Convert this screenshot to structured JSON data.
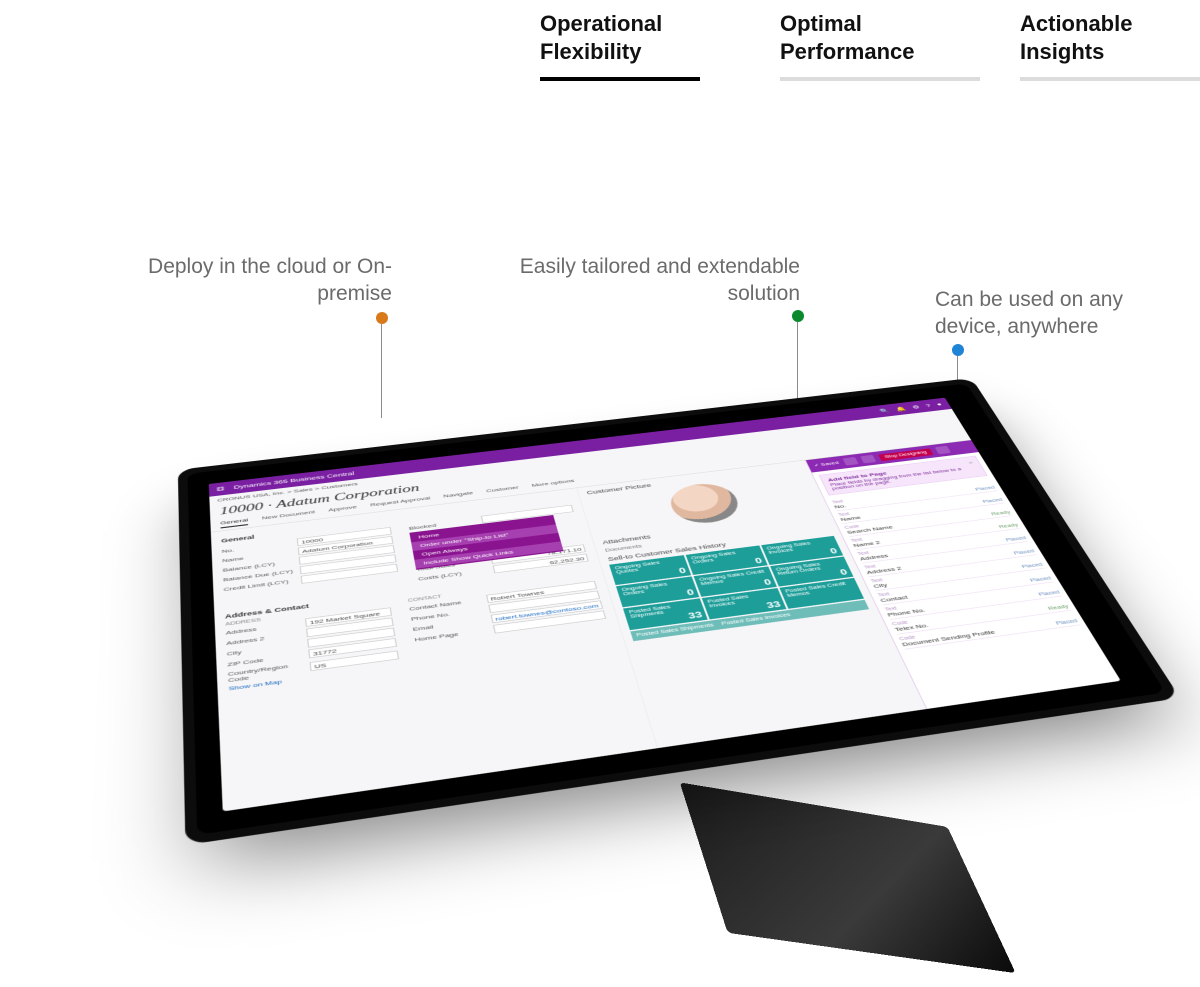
{
  "tabs": [
    {
      "label": "Operational\nFlexibility",
      "active": true
    },
    {
      "label": "Optimal\nPerformance",
      "active": false
    },
    {
      "label": "Actionable\nInsights",
      "active": false
    }
  ],
  "callouts": {
    "deploy": "Deploy in the cloud or On-premise",
    "tailor": "Easily tailored and extendable solution",
    "device": "Can be used on any device, anywhere"
  },
  "app": {
    "product": "Dynamics 365 Business Central",
    "breadcrumb": "CRONUS USA, Inc. > Sales > Customers",
    "page_title": "10000 · Adatum Corporation",
    "ribbon": [
      "General",
      "New Document",
      "Approve",
      "Request Approval",
      "Navigate",
      "Customer",
      "More options"
    ],
    "ribbon_active": "General",
    "sections": {
      "general": {
        "title": "General",
        "fields": {
          "no": {
            "label": "No.",
            "value": "10000"
          },
          "name": {
            "label": "Name",
            "value": "Adatum Corporation"
          },
          "balance": {
            "label": "Balance (LCY)",
            "value": ""
          },
          "balance_due": {
            "label": "Balance Due (LCY)",
            "value": ""
          },
          "credit_limit": {
            "label": "Credit Limit (LCY)",
            "value": ""
          },
          "blocked": {
            "label": "Blocked",
            "value": ""
          },
          "total_sales": {
            "label": "Total Sales",
            "value": "78,171.10"
          },
          "costs": {
            "label": "Costs (LCY)",
            "value": "62,252.30"
          }
        },
        "dropdown": {
          "title": "Home",
          "items": [
            "Home",
            "Order under \"Ship-to List\"",
            "Open Always",
            "Include Show Quick Links"
          ]
        }
      },
      "address": {
        "title": "Address & Contact",
        "left": {
          "address": {
            "label": "Address",
            "value": "192 Market Square"
          },
          "address2": {
            "label": "Address 2",
            "value": ""
          },
          "city": {
            "label": "City",
            "value": ""
          },
          "zip": {
            "label": "ZIP Code",
            "value": "31772"
          },
          "country": {
            "label": "Country/Region Code",
            "value": "US"
          },
          "show_map": "Show on Map"
        },
        "right_header": "CONTACT",
        "right": {
          "contact_name": {
            "label": "Contact Name",
            "value": "Robert Townes"
          },
          "phone": {
            "label": "Phone No.",
            "value": ""
          },
          "email": {
            "label": "Email",
            "value": "robert.townes@contoso.com"
          },
          "homepage": {
            "label": "Home Page",
            "value": ""
          }
        }
      }
    },
    "factbox": {
      "picture_title": "Customer Picture",
      "attachments_title": "Attachments",
      "attachments_sub": "Documents",
      "history_title": "Sell-to Customer Sales History",
      "tiles": [
        {
          "label": "Ongoing Sales Quotes",
          "value": "0"
        },
        {
          "label": "Ongoing Sales Orders",
          "value": "0"
        },
        {
          "label": "Ongoing Sales Invoices",
          "value": "0"
        },
        {
          "label": "Ongoing Sales Orders",
          "value": "0"
        },
        {
          "label": "Ongoing Sales Credit Memos",
          "value": "0"
        },
        {
          "label": "Ongoing Sales Return Orders",
          "value": "0"
        },
        {
          "label": "Posted Sales Shipments",
          "value": "33"
        },
        {
          "label": "Posted Sales Invoices",
          "value": "33"
        },
        {
          "label": "Posted Sales Credit Memos",
          "value": ""
        }
      ],
      "footer": [
        "Posted Sales Shipments",
        "Posted Sales Invoices"
      ]
    },
    "designer": {
      "saved_label": "Saved",
      "top_button": "Stop Designing",
      "card_title": "Add field to Page",
      "card_sub": "Place fields by dragging from the list below to a position on the page.",
      "card_close": "×",
      "fields": [
        {
          "type": "Text",
          "name": "No.",
          "status": "Placed"
        },
        {
          "type": "Text",
          "name": "Name",
          "status": "Placed"
        },
        {
          "type": "Code",
          "name": "Search Name",
          "status": "Ready"
        },
        {
          "type": "Text",
          "name": "Name 2",
          "status": "Ready"
        },
        {
          "type": "Text",
          "name": "Address",
          "status": "Placed"
        },
        {
          "type": "Text",
          "name": "Address 2",
          "status": "Placed"
        },
        {
          "type": "Text",
          "name": "City",
          "status": "Placed"
        },
        {
          "type": "Text",
          "name": "Contact",
          "status": "Placed"
        },
        {
          "type": "Text",
          "name": "Phone No.",
          "status": "Placed"
        },
        {
          "type": "Code",
          "name": "Telex No.",
          "status": "Ready"
        },
        {
          "type": "Code",
          "name": "Document Sending Profile",
          "status": "Placed"
        }
      ]
    }
  }
}
